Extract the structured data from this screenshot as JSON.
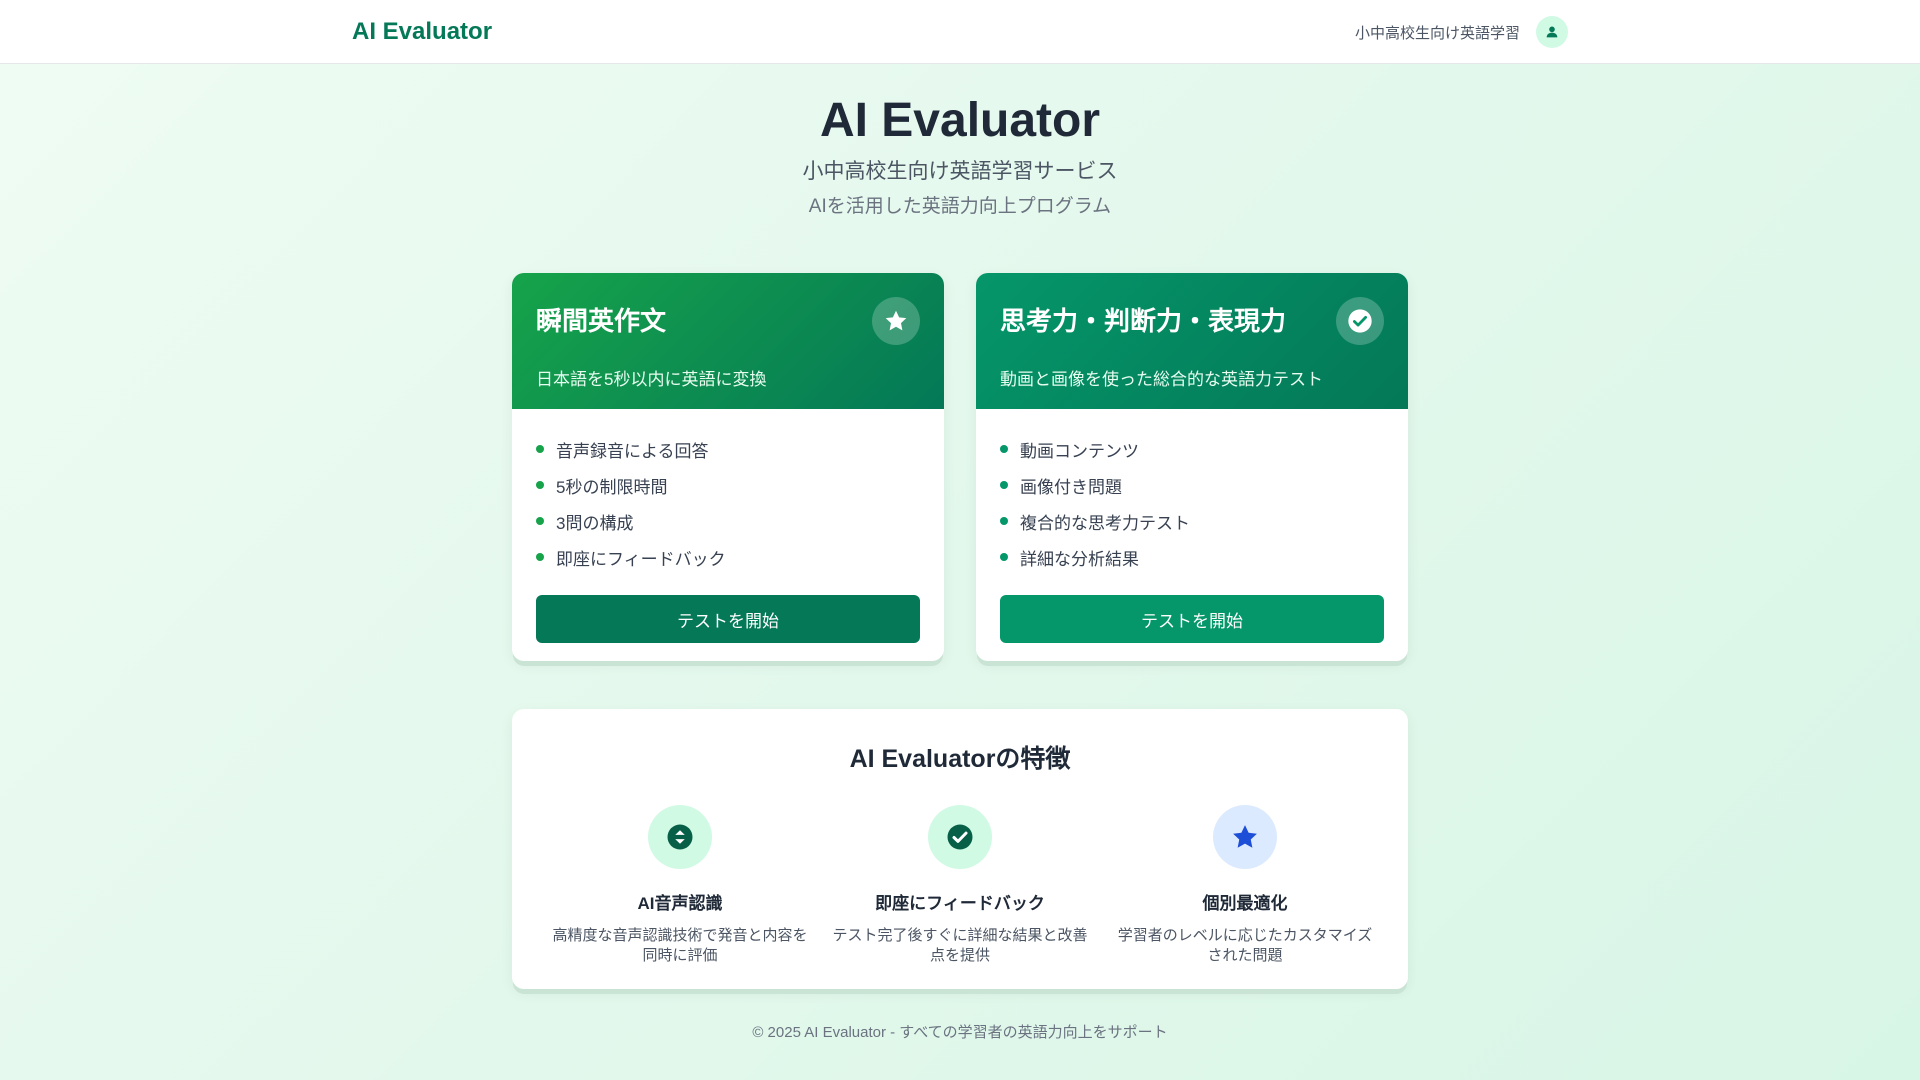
{
  "header": {
    "brand": "AI Evaluator",
    "service_label": "小中高校生向け英語学習",
    "avatar_icon": "user-icon"
  },
  "hero": {
    "title": "AI Evaluator",
    "subtitle": "小中高校生向け英語学習サービス",
    "tagline": "AIを活用した英語力向上プログラム"
  },
  "cards": [
    {
      "title": "瞬間英作文",
      "description": "日本語を5秒以内に英語に変換",
      "icon": "star-icon",
      "features": [
        "音声録音による回答",
        "5秒の制限時間",
        "3問の構成",
        "即座にフィードバック"
      ],
      "button_label": "テストを開始",
      "accent": "#047857"
    },
    {
      "title": "思考力・判断力・表現力",
      "description": "動画と画像を使った総合的な英語力テスト",
      "icon": "check-circle-icon",
      "features": [
        "動画コンテンツ",
        "画像付き問題",
        "複合的な思考力テスト",
        "詳細な分析結果"
      ],
      "button_label": "テストを開始",
      "accent": "#059669"
    }
  ],
  "features_section": {
    "title": "AI Evaluatorの特徴",
    "items": [
      {
        "icon": "voice-recognition-icon",
        "title": "AI音声認識",
        "description": "高精度な音声認識技術で発音と内容を同時に評価"
      },
      {
        "icon": "check-circle-icon",
        "title": "即座にフィードバック",
        "description": "テスト完了後すぐに詳細な結果と改善点を提供"
      },
      {
        "icon": "star-icon",
        "title": "個別最適化",
        "description": "学習者のレベルに応じたカスタマイズされた問題"
      }
    ]
  },
  "footer": {
    "text": "© 2025 AI Evaluator - すべての学習者の英語力向上をサポート"
  }
}
